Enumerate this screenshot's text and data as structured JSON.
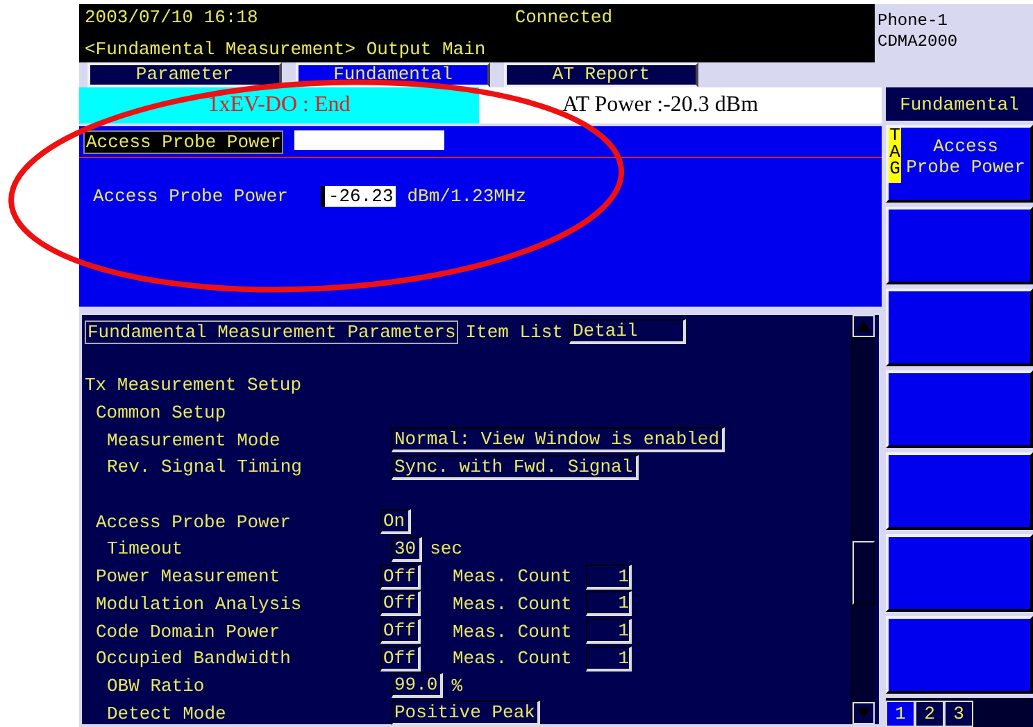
{
  "header": {
    "datetime": "2003/07/10 16:18",
    "status": "Connected",
    "screen_title": "<Fundamental Measurement> Output Main",
    "device": "Phone-1",
    "system": "CDMA2000"
  },
  "tabs": [
    {
      "label": "Parameter",
      "selected": false
    },
    {
      "label": "Fundamental",
      "selected": true
    },
    {
      "label": "AT Report",
      "selected": false
    }
  ],
  "call_state": "1xEV-DO : End",
  "at_power": "AT Power :-20.3 dBm",
  "result_panel": {
    "title": "Access Probe Power",
    "label": "Access Probe Power",
    "value": "-26.23",
    "unit": "dBm/1.23MHz"
  },
  "parameters": {
    "title": "Fundamental Measurement Parameters",
    "item_list_label": "Item List",
    "item_list_value": "Detail",
    "items": [
      {
        "kind": "group",
        "label": "Tx Measurement Setup",
        "children": [
          {
            "kind": "group",
            "label": "Common Setup",
            "children": [
              {
                "kind": "setting",
                "label": "Measurement Mode",
                "value": "Normal: View Window is enabled"
              },
              {
                "kind": "setting",
                "label": "Rev. Signal Timing",
                "value": "Sync. with Fwd. Signal"
              }
            ]
          },
          {
            "kind": "setting",
            "label": "Access Probe Power",
            "value": "On",
            "children": [
              {
                "kind": "setting",
                "label": "Timeout",
                "value": "30",
                "unit": "sec"
              }
            ]
          },
          {
            "kind": "setting",
            "label": "Power Measurement",
            "value": "Off",
            "count_label": "Meas. Count",
            "count": "1"
          },
          {
            "kind": "setting",
            "label": "Modulation Analysis",
            "value": "Off",
            "count_label": "Meas. Count",
            "count": "1"
          },
          {
            "kind": "setting",
            "label": "Code Domain Power",
            "value": "Off",
            "count_label": "Meas. Count",
            "count": "1"
          },
          {
            "kind": "setting",
            "label": "Occupied Bandwidth",
            "value": "Off",
            "count_label": "Meas. Count",
            "count": "1",
            "children": [
              {
                "kind": "setting",
                "label": "OBW Ratio",
                "value": "99.0",
                "unit": "%"
              },
              {
                "kind": "setting",
                "label": "Detect Mode",
                "value": "Positive Peak"
              }
            ]
          }
        ]
      }
    ]
  },
  "softkeys": {
    "title": "Fundamental",
    "keys": [
      {
        "tag": "TAG",
        "label": "Access Probe Power"
      }
    ]
  },
  "pages": [
    {
      "label": "1",
      "selected": true
    },
    {
      "label": "2",
      "selected": false
    },
    {
      "label": "3",
      "selected": false
    }
  ]
}
